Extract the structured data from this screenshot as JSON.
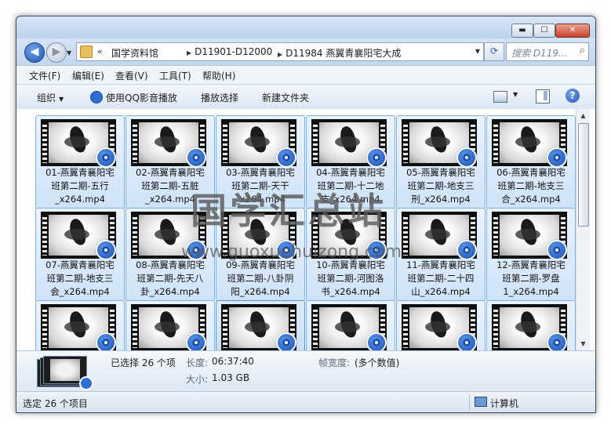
{
  "window": {
    "buttons": {
      "minimize": "▬",
      "maximize": "☐",
      "close": "✕"
    }
  },
  "nav": {
    "back": "◀",
    "forward": "▶",
    "address_prefix": "«",
    "breadcrumbs": [
      "国学资料馆",
      "D11901-D12000",
      "D11984 燕翼青襄阳宅大成"
    ],
    "search_placeholder": "搜索 D119..."
  },
  "menu": [
    "文件(F)",
    "编辑(E)",
    "查看(V)",
    "工具(T)",
    "帮助(H)"
  ],
  "toolbar": {
    "organize": "组织",
    "qq_play": "使用QQ影音播放",
    "playlist": "播放选择",
    "new_folder": "新建文件夹"
  },
  "files": [
    {
      "name": "01-燕翼青襄阳宅班第二期-五行_x264.mp4"
    },
    {
      "name": "02-燕翼青襄阳宅班第二期-五脏_x264.mp4"
    },
    {
      "name": "03-燕翼青襄阳宅班第二期-天干_x264.mp4"
    },
    {
      "name": "04-燕翼青襄阳宅班第二期-十二地支_x264.mp4"
    },
    {
      "name": "05-燕翼青襄阳宅班第二期-地支三刑_x264.mp4"
    },
    {
      "name": "06-燕翼青襄阳宅班第二期-地支三合_x264.mp4"
    },
    {
      "name": "07-燕翼青襄阳宅班第二期-地支三会_x264.mp4"
    },
    {
      "name": "08-燕翼青襄阳宅班第二期-先天八卦_x264.mp4"
    },
    {
      "name": "09-燕翼青襄阳宅班第二期-八卦阴阳_x264.mp4"
    },
    {
      "name": "10-燕翼青襄阳宅班第二期-河图洛书_x264.mp4"
    },
    {
      "name": "11-燕翼青襄阳宅班第二期-二十四山_x264.mp4"
    },
    {
      "name": "12-燕翼青襄阳宅班第二期-罗盘1_x264.mp4"
    }
  ],
  "labels": [
    [
      "01-燕翼青襄阳宅",
      "班第二期-五行",
      "_x264.mp4"
    ],
    [
      "02-燕翼青襄阳宅",
      "班第二期-五脏",
      "_x264.mp4"
    ],
    [
      "03-燕翼青襄阳宅",
      "班第二期-天干",
      "_x264.mp4"
    ],
    [
      "04-燕翼青襄阳宅",
      "班第二期-十二地",
      "支_x264.mp4"
    ],
    [
      "05-燕翼青襄阳宅",
      "班第二期-地支三",
      "刑_x264.mp4"
    ],
    [
      "06-燕翼青襄阳宅",
      "班第二期-地支三",
      "合_x264.mp4"
    ],
    [
      "07-燕翼青襄阳宅",
      "班第二期-地支三",
      "会_x264.mp4"
    ],
    [
      "08-燕翼青襄阳宅",
      "班第二期-先天八",
      "卦_x264.mp4"
    ],
    [
      "09-燕翼青襄阳宅",
      "班第二期-八卦阴",
      "阳_x264.mp4"
    ],
    [
      "10-燕翼青襄阳宅",
      "班第二期-河图洛",
      "书_x264.mp4"
    ],
    [
      "11-燕翼青襄阳宅",
      "班第二期-二十四",
      "山_x264.mp4"
    ],
    [
      "12-燕翼青襄阳宅",
      "班第二期-罗盘",
      "1_x264.mp4"
    ]
  ],
  "details": {
    "selected": "已选择 26 个项",
    "length_label": "长度:",
    "length_value": "06:37:40",
    "size_label": "大小:",
    "size_value": "1.03 GB",
    "framewidth_label": "帧宽度:",
    "framewidth_value": "(多个数值)"
  },
  "status": {
    "left": "选定 26 个项目",
    "right": "计算机"
  },
  "watermark": {
    "title": "国学汇总站",
    "url": "www.guoxuehuizong.com"
  },
  "icons": {
    "back": "back-arrow-icon",
    "forward": "forward-arrow-icon",
    "refresh": "refresh-icon",
    "search": "search-icon",
    "help": "help-icon",
    "qq": "qq-player-icon"
  },
  "colors": {
    "accent": "#2d6fd3",
    "selection_border": "#7fb0e6"
  }
}
